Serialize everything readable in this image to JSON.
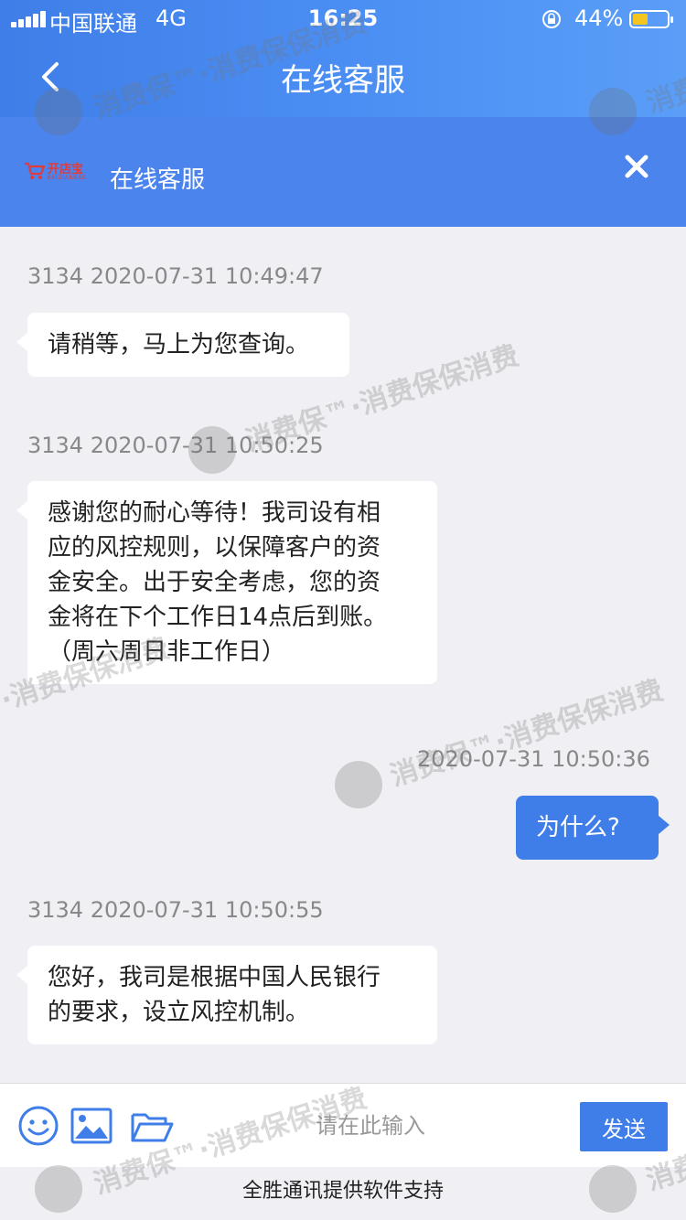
{
  "status_bar": {
    "carrier": "中国联通",
    "network": "4G",
    "time": "16:25",
    "battery_percent": "44%",
    "battery_level": 0.44
  },
  "nav": {
    "title": "在线客服",
    "back_icon": "chevron-left-icon"
  },
  "service_header": {
    "logo_text": "开店宝",
    "logo_sub": "KAIDIANBAO",
    "title": "在线客服",
    "close_icon": "close-icon"
  },
  "messages": [
    {
      "side": "left",
      "timestamp": "3134 2020-07-31 10:49:47",
      "text": "请稍等，马上为您查询。"
    },
    {
      "side": "left",
      "timestamp": "3134 2020-07-31 10:50:25",
      "lines": [
        "感谢您的耐心等待！我司设有相",
        "应的风控规则，以保障客户的资",
        "金安全。出于安全考虑，您的资",
        "金将在下个工作日14点后到账。",
        "（周六周日非工作日）"
      ]
    },
    {
      "side": "right",
      "timestamp": "2020-07-31 10:50:36",
      "text": "为什么?"
    },
    {
      "side": "left",
      "timestamp": "3134 2020-07-31 10:50:55",
      "lines": [
        "您好，我司是根据中国人民银行",
        "的要求，设立风控机制。"
      ]
    }
  ],
  "input_bar": {
    "placeholder": "请在此输入",
    "send_label": "发送",
    "tools": [
      "emoji-icon",
      "image-icon",
      "folder-icon"
    ]
  },
  "footer": {
    "text": "全胜通讯提供软件支持"
  },
  "watermark": {
    "text_a": "消费保™·消费保保消费",
    "text_b": "消费保"
  }
}
